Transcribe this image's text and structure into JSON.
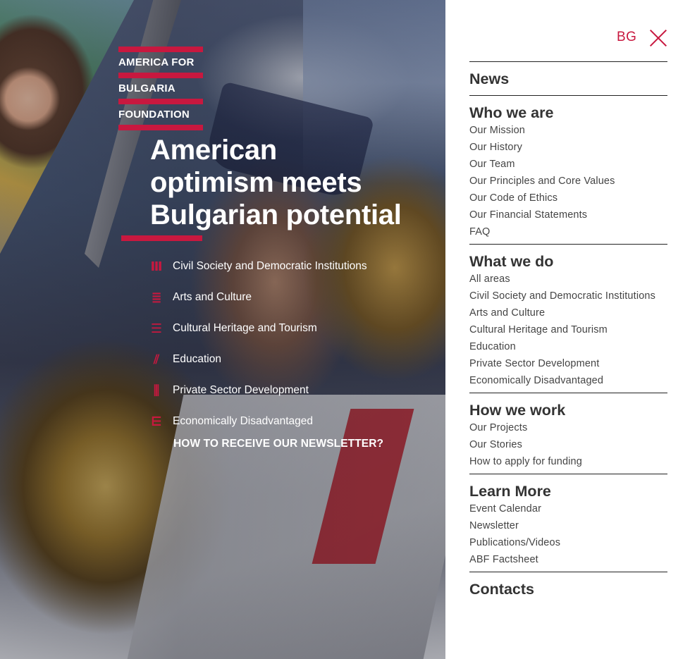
{
  "logo": {
    "lines": [
      "AMERICA FOR",
      "BULGARIA",
      "FOUNDATION"
    ],
    "accent_color": "#c8183f"
  },
  "hero": {
    "headline": [
      "American",
      "optimism meets",
      "Bulgarian potential"
    ],
    "areas": [
      {
        "label": "Civil Society and Democratic Institutions",
        "icon": "columns-icon"
      },
      {
        "label": "Arts and Culture",
        "icon": "arts-icon"
      },
      {
        "label": "Cultural Heritage and Tourism",
        "icon": "heritage-icon"
      },
      {
        "label": "Education",
        "icon": "education-icon"
      },
      {
        "label": "Private Sector Development",
        "icon": "business-icon"
      },
      {
        "label": "Economically Disadvantaged",
        "icon": "support-icon"
      }
    ],
    "newsletter_link": "HOW TO RECEIVE OUR NEWSLETTER?"
  },
  "menu": {
    "language": "BG",
    "sections": [
      {
        "title": "News",
        "items": []
      },
      {
        "title": "Who we are",
        "items": [
          "Our Mission",
          "Our History",
          "Our Team",
          "Our Principles and Core Values",
          "Our Code of Ethics",
          "Our Financial Statements",
          "FAQ"
        ]
      },
      {
        "title": "What we do",
        "items": [
          "All areas",
          "Civil Society and Democratic Institutions",
          "Arts and Culture",
          "Cultural Heritage and Tourism",
          "Education",
          "Private Sector Development",
          "Economically Disadvantaged"
        ]
      },
      {
        "title": "How we work",
        "items": [
          "Our Projects",
          "Our Stories",
          "How to apply for funding"
        ]
      },
      {
        "title": "Learn More",
        "items": [
          "Event Calendar",
          "Newsletter",
          "Publications/Videos",
          "ABF Factsheet"
        ]
      },
      {
        "title": "Contacts",
        "items": []
      }
    ]
  },
  "colors": {
    "brand_red": "#c8183f",
    "text_dark": "#333333"
  }
}
